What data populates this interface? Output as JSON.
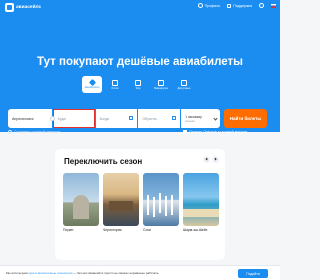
{
  "header": {
    "logo_text": "авиасейлс",
    "profile_label": "Профиль",
    "support_label": "Поддержка"
  },
  "hero": {
    "title": "Тут покупают дешёвые авиабилеты"
  },
  "categories": [
    {
      "label": "Авиабилеты",
      "icon": "plane-icon",
      "active": true
    },
    {
      "label": "Отели",
      "icon": "hotel-icon",
      "active": false
    },
    {
      "label": "Ж/д",
      "icon": "train-icon",
      "active": false
    },
    {
      "label": "Маршрутка",
      "icon": "bus-icon",
      "active": false
    },
    {
      "label": "Досуговые",
      "icon": "ticket-icon",
      "active": false
    }
  ],
  "search": {
    "from_value": "Апресиловск",
    "to_placeholder": "Куда",
    "depart_placeholder": "Когда",
    "return_placeholder": "Обратно",
    "passengers_value": "1 пассажир",
    "class_value": "эконом",
    "find_label": "Найти билеты"
  },
  "options": {
    "compose_route_label": "Составить сложный маршрут",
    "ostrovok_label": "Открыть Ostrovok.ru в новой вкладке"
  },
  "season": {
    "title": "Переключить сезон",
    "cards": [
      {
        "name": "Пхукет"
      },
      {
        "name": "Черногория"
      },
      {
        "name": "Сочи"
      },
      {
        "name": "Шарм-эш-Шейх"
      }
    ]
  },
  "cookie": {
    "prefix": "Мы используем ",
    "link": "куки и аналогичные технологии",
    "suffix": " — без них Авиасейлс просто не сможет нормально работать.",
    "button_label": "Подойти"
  },
  "colors": {
    "brand": "#1b8df0",
    "accent": "#ff6d00"
  }
}
